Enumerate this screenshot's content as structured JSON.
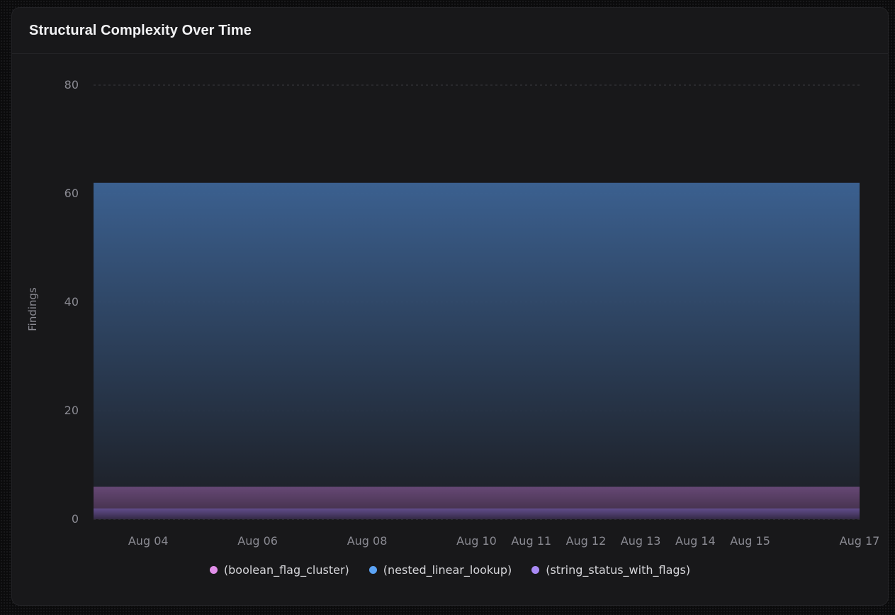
{
  "card": {
    "title": "Structural Complexity Over Time"
  },
  "chart_data": {
    "type": "area",
    "title": "Structural Complexity Over Time",
    "xlabel": "",
    "ylabel": "Findings",
    "ylim": [
      0,
      80
    ],
    "yticks": [
      "0",
      "20",
      "40",
      "60",
      "80"
    ],
    "x": [
      "Aug 04",
      "Aug 06",
      "Aug 08",
      "Aug 10",
      "Aug 11",
      "Aug 12",
      "Aug 13",
      "Aug 14",
      "Aug 15",
      "Aug 17"
    ],
    "x_dates": [
      "2025-08-04",
      "2025-08-06",
      "2025-08-08",
      "2025-08-10",
      "2025-08-11",
      "2025-08-12",
      "2025-08-13",
      "2025-08-14",
      "2025-08-15",
      "2025-08-17"
    ],
    "x_range": [
      "2025-08-03",
      "2025-08-17"
    ],
    "grid": true,
    "legend": "bottom",
    "series": [
      {
        "name": "(boolean_flag_cluster)",
        "color": "#e08ee8",
        "values": [
          6,
          6,
          6,
          6,
          6,
          6,
          6,
          6,
          6,
          6
        ]
      },
      {
        "name": "(nested_linear_lookup)",
        "color": "#5ba3f5",
        "values": [
          62,
          62,
          62,
          62,
          62,
          62,
          62,
          62,
          62,
          62
        ]
      },
      {
        "name": "(string_status_with_flags)",
        "color": "#a98af5",
        "values": [
          2,
          2,
          2,
          2,
          2,
          2,
          2,
          2,
          2,
          2
        ]
      }
    ]
  }
}
